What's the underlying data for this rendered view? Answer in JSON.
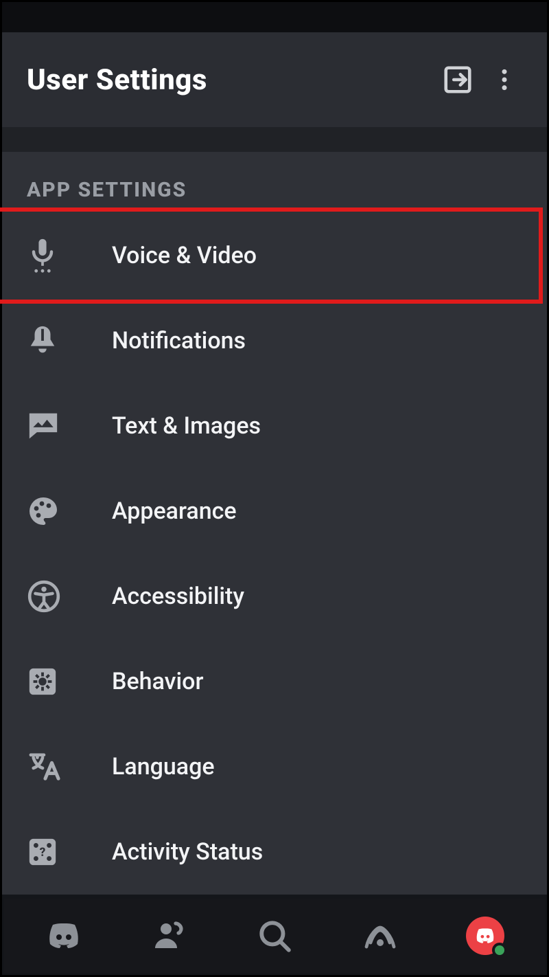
{
  "header": {
    "title": "User Settings"
  },
  "section": {
    "label": "APP SETTINGS"
  },
  "items": [
    {
      "label": "Voice & Video",
      "highlight": true
    },
    {
      "label": "Notifications"
    },
    {
      "label": "Text & Images"
    },
    {
      "label": "Appearance"
    },
    {
      "label": "Accessibility"
    },
    {
      "label": "Behavior"
    },
    {
      "label": "Language"
    },
    {
      "label": "Activity Status"
    }
  ]
}
